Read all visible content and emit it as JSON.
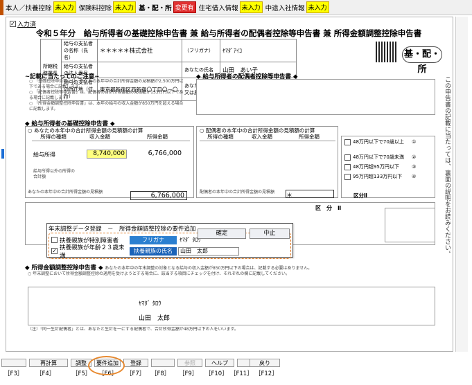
{
  "tabs": [
    {
      "label": "本人／扶養控除",
      "status": "未入力"
    },
    {
      "label": "保険料控除",
      "status": "未入力"
    },
    {
      "label": "基・配・所",
      "status": "変更有",
      "active": true
    },
    {
      "label": "住宅借入情報",
      "status": "未入力"
    },
    {
      "label": "中途入社情報",
      "status": "未入力"
    }
  ],
  "input_check": "入力済",
  "form_title": "令和５年分　給与所得者の基礎控除申告書 兼 給与所得者の配偶者控除等申告書 兼 所得金額調整控除申告書",
  "header": {
    "office_label": "所轄税務署長",
    "payer_name_label": "給与の支払者の名称（氏名）",
    "payer_name": "＊＊＊＊＊株式会社",
    "payer_corp_label": "給与の支払者の法人番号",
    "payer_addr_label": "給与の支払者の所在地（住所）",
    "payer_addr": "東京都新宿区西新宿〇丁目〇－〇",
    "furigana_label": "（フリガナ）",
    "furigana": "ﾔﾏﾀﾞｱｲｺ",
    "name_label": "あなたの氏名",
    "name": "山田　あい子",
    "address_label": "あなたの住所又は居所",
    "badge": "基・配・所"
  },
  "notes_title": "~記載に当たってのご注意~",
  "basic_title": "◆ 給与所得者の基礎控除申告書 ◆",
  "basic_sub": "○ あなたの本年中の合計所得金額の見積額の計算",
  "basic_cols": [
    "所得の種類",
    "収入金額",
    "所得金額"
  ],
  "basic_row1_label": "給与所得",
  "basic_income": "8,740,000",
  "basic_amount": "6,766,000",
  "basic_row2_label": "給与所得以外の所得の合計額",
  "basic_total_label": "あなたの本年中の合計所得金額の見積額",
  "basic_total": "6,766,000",
  "spouse_title": "◆ 給与所得者の配偶者控除等申告書 ◆",
  "spouse_sub": "○ 配偶者の本年中の合計所得金額の見積額の計算",
  "spouse_cols": [
    "所得の種類",
    "収入金額",
    "所得金額"
  ],
  "spouse_total_label": "配偶者の本年中の合計所得金額の見積額",
  "spouse_total": "＊",
  "right_labels": [
    "48万円以下で70歳以上",
    "48万円以下で70歳未満",
    "48万円超95万円以下",
    "95万円超133万円以下"
  ],
  "right_codes": [
    "①",
    "②",
    "③",
    "④"
  ],
  "kubun_label": "区分Ⅱ",
  "kubun_mid": "区　分　Ⅱ",
  "adj_title": "◆ 所得金額調整控除申告書 ◆",
  "adj_note": "あなたの本年中の年末調整の対象となる給与の収入金額が850万円以下の場合は、記載する必要はありません。",
  "dialog": {
    "title": "年末調整データ登録　－　所得金額調整控除の要件追加",
    "row1_check": "扶養親族が特別障害者",
    "row1_furigana_label": "フリガナ",
    "row1_furigana": "ﾔﾏﾀﾞ ﾀﾛｳ",
    "row2_check": "扶養親族が年齢２３歳未満",
    "row2_name_label": "扶養親族の氏名",
    "row2_name": "山田　太郎",
    "confirm": "確定",
    "cancel": "中止"
  },
  "adj_table": {
    "furigana": "ﾔﾏﾀﾞ ﾀﾛｳ",
    "name": "山田　太郎"
  },
  "fkeys": [
    {
      "label": "",
      "key": "［F3］"
    },
    {
      "label": "再計算",
      "key": "［F4］"
    },
    {
      "label": "調整",
      "key": "［F5］"
    },
    {
      "label": "要件追加",
      "key": "［F6］"
    },
    {
      "label": "登録",
      "key": "［F7］"
    },
    {
      "label": "",
      "key": "［F8］"
    },
    {
      "label": "参照",
      "key": "［F9］"
    },
    {
      "label": "ヘルプ",
      "key": "［F10］"
    },
    {
      "label": "",
      "key": "［F11］"
    },
    {
      "label": "戻り",
      "key": "［F12］"
    }
  ],
  "side_note": "この申告書の記載に当たっては、裏面の説明をお読みください。"
}
